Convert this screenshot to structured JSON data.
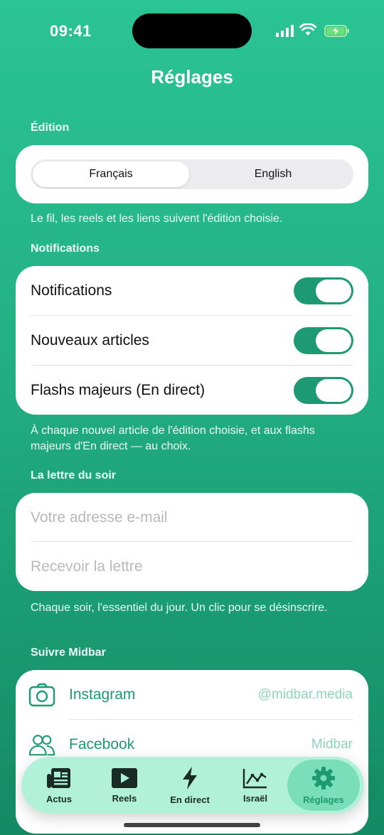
{
  "status_bar": {
    "time": "09:41"
  },
  "title": "Réglages",
  "edition": {
    "label": "Édition",
    "options": [
      "Français",
      "English"
    ],
    "selected": "Français",
    "footnote": "Le fil, les reels et les liens suivent l'édition choisie."
  },
  "notifications": {
    "label": "Notifications",
    "items": [
      {
        "label": "Notifications",
        "on": true
      },
      {
        "label": "Nouveaux articles",
        "on": true
      },
      {
        "label": "Flashs majeurs (En direct)",
        "on": true
      }
    ],
    "footnote": "À chaque nouvel article de l'édition choisie, et aux flashs majeurs d'En direct — au choix."
  },
  "newsletter": {
    "label": "La lettre du soir",
    "email_placeholder": "Votre adresse e-mail",
    "submit_label": "Recevoir la lettre",
    "footnote": "Chaque soir, l'essentiel du jour. Un clic pour se désinscrire."
  },
  "follow": {
    "label": "Suivre Midbar",
    "items": [
      {
        "name": "Instagram",
        "handle": "@midbar.media",
        "icon": "camera-icon"
      },
      {
        "name": "Facebook",
        "handle": "Midbar",
        "icon": "people-icon"
      }
    ]
  },
  "tabbar": {
    "items": [
      {
        "label": "Actus",
        "icon": "newspaper-icon"
      },
      {
        "label": "Reels",
        "icon": "play-icon"
      },
      {
        "label": "En direct",
        "icon": "bolt-icon"
      },
      {
        "label": "Israël",
        "icon": "chart-icon"
      },
      {
        "label": "Réglages",
        "icon": "gear-icon"
      }
    ],
    "active": "Réglages"
  },
  "colors": {
    "accent": "#1e9a72",
    "background": "#22ae82"
  }
}
